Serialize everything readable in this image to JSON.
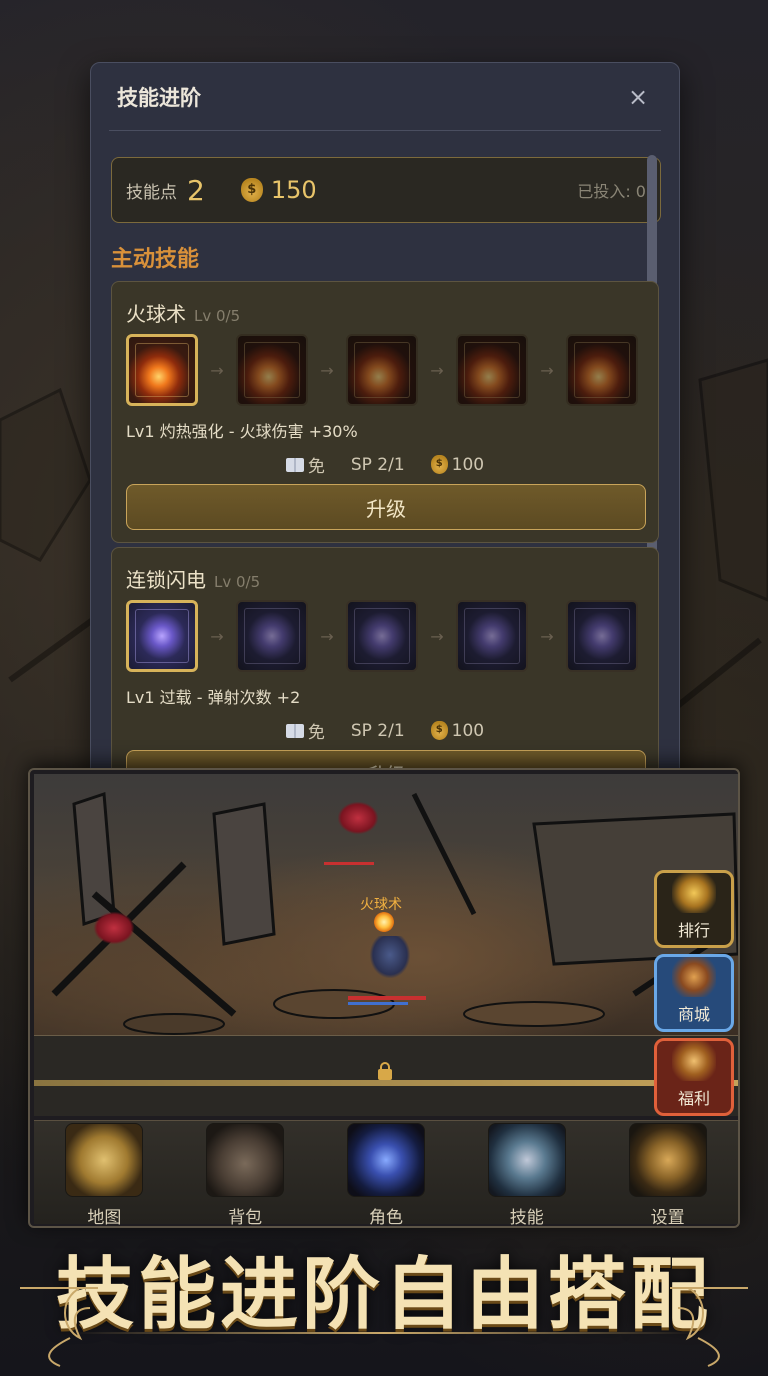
{
  "modal": {
    "title": "技能进阶",
    "close_glyph": "×",
    "skill_points_label": "技能点",
    "skill_points_value": "2",
    "gold_value": "150",
    "invested_label": "已投入: 0",
    "section_title": "主动技能"
  },
  "skills": [
    {
      "name": "火球术",
      "level": "Lv 0/5",
      "icon": "fireball-icon",
      "desc": "Lv1 灼热强化 - 火球伤害 +30%",
      "cost_book": "免",
      "cost_sp": "SP 2/1",
      "cost_gold": "100",
      "upgrade_label": "升级"
    },
    {
      "name": "连锁闪电",
      "level": "Lv 0/5",
      "icon": "lightning-icon",
      "desc": "Lv1 过载 - 弹射次数 +2",
      "cost_book": "免",
      "cost_sp": "SP 2/1",
      "cost_gold": "100",
      "upgrade_label": "升级"
    }
  ],
  "battle": {
    "floating_text": "火球术"
  },
  "side_buttons": [
    {
      "label": "排行",
      "icon": "trophy-icon",
      "color": "#c9a04a"
    },
    {
      "label": "商城",
      "icon": "shop-icon",
      "color": "#6aa8e8"
    },
    {
      "label": "福利",
      "icon": "gift-icon",
      "color": "#e0603a"
    }
  ],
  "nav": [
    {
      "label": "地图",
      "icon": "map-icon"
    },
    {
      "label": "背包",
      "icon": "backpack-icon"
    },
    {
      "label": "角色",
      "icon": "character-icon"
    },
    {
      "label": "技能",
      "icon": "skill-book-icon"
    },
    {
      "label": "设置",
      "icon": "gear-icon"
    }
  ],
  "banner": {
    "text": "技能进阶自由搭配"
  },
  "colors": {
    "accent_gold": "#e8c46a",
    "section_orange": "#d9913a",
    "modal_bg": "#2e3140"
  }
}
